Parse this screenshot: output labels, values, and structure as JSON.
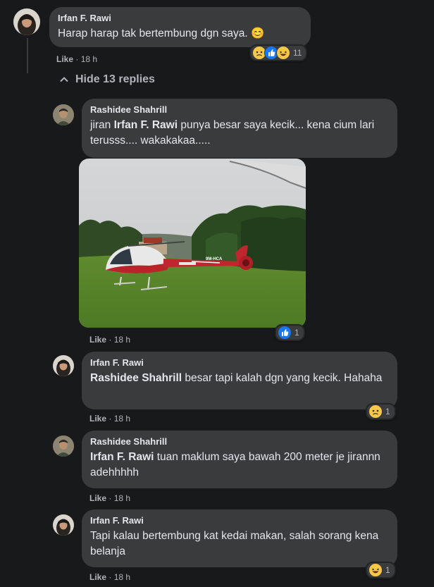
{
  "top_comment": {
    "author": "Irfan F. Rawi",
    "text": "Harap harap tak bertembung dgn saya. 😊",
    "like_label": "Like",
    "time": "18 h",
    "reaction_count": "11"
  },
  "hide_replies_label": "Hide 13 replies",
  "replies": [
    {
      "author": "Rashidee Shahrill",
      "text_pre": "jiran ",
      "mention": "Irfan F. Rawi",
      "text_post": " punya besar saya kecik... kena cium lari terusss.... wakakakaa.....",
      "like_label": "Like",
      "time": "18 h",
      "reaction_count": "1",
      "helicopter_reg": "9M-HCA"
    },
    {
      "author": "Irfan F. Rawi",
      "mention": "Rashidee Shahrill",
      "text_post": " besar tapi kalah dgn yang kecik. Hahaha",
      "like_label": "Like",
      "time": "18 h",
      "reaction_count": "1"
    },
    {
      "author": "Rashidee Shahrill",
      "mention": "Irfan F. Rawi",
      "text_post": " tuan maklum saya bawah 200 meter je jirannn adehhhhh",
      "like_label": "Like",
      "time": "18 h"
    },
    {
      "author": "Irfan F. Rawi",
      "text": "Tapi kalau bertembung kat kedai makan, salah sorang kena belanja",
      "like_label": "Like",
      "time": "18 h",
      "reaction_count": "1"
    }
  ],
  "colors": {
    "background": "#18191a",
    "bubble": "#3a3b3c",
    "text": "#e4e6eb",
    "muted": "#b0b3b8",
    "like_blue": "#1877f2"
  },
  "icons": {
    "chevron": "chevron-up-icon",
    "reactions": [
      "sad-icon",
      "like-icon",
      "haha-icon"
    ]
  }
}
